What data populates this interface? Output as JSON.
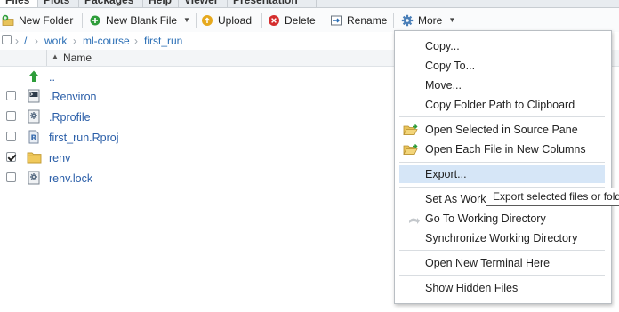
{
  "tabs": [
    "Files",
    "Plots",
    "Packages",
    "Help",
    "Viewer",
    "Presentation"
  ],
  "toolbar": {
    "new_folder": "New Folder",
    "new_blank_file": "New Blank File",
    "upload": "Upload",
    "delete": "Delete",
    "rename": "Rename",
    "more": "More"
  },
  "breadcrumb": {
    "root": "/",
    "items": [
      "work",
      "ml-course",
      "first_run"
    ]
  },
  "columns": {
    "name": "Name"
  },
  "files": [
    {
      "name": "..",
      "checked": false,
      "icon": "up-arrow-icon"
    },
    {
      "name": ".Renviron",
      "checked": false,
      "icon": "terminal-file-icon"
    },
    {
      "name": ".Rprofile",
      "checked": false,
      "icon": "gear-file-icon"
    },
    {
      "name": "first_run.Rproj",
      "checked": false,
      "icon": "rproj-file-icon"
    },
    {
      "name": "renv",
      "checked": true,
      "icon": "folder-icon"
    },
    {
      "name": "renv.lock",
      "checked": false,
      "icon": "gear-file-icon"
    }
  ],
  "menu": {
    "copy": "Copy...",
    "copy_to": "Copy To...",
    "move": "Move...",
    "copy_path": "Copy Folder Path to Clipboard",
    "open_source": "Open Selected in Source Pane",
    "open_columns": "Open Each File in New Columns",
    "export": "Export...",
    "set_wd": "Set As Working Directory",
    "go_wd": "Go To Working Directory",
    "sync_wd": "Synchronize Working Directory",
    "terminal": "Open New Terminal Here",
    "hidden": "Show Hidden Files"
  },
  "tooltip": "Export selected files or folders",
  "colors": {
    "link": "#2a5ea8",
    "highlight": "#d6e6f7",
    "accent_green": "#2e9d3a",
    "accent_red": "#d42d2d"
  }
}
